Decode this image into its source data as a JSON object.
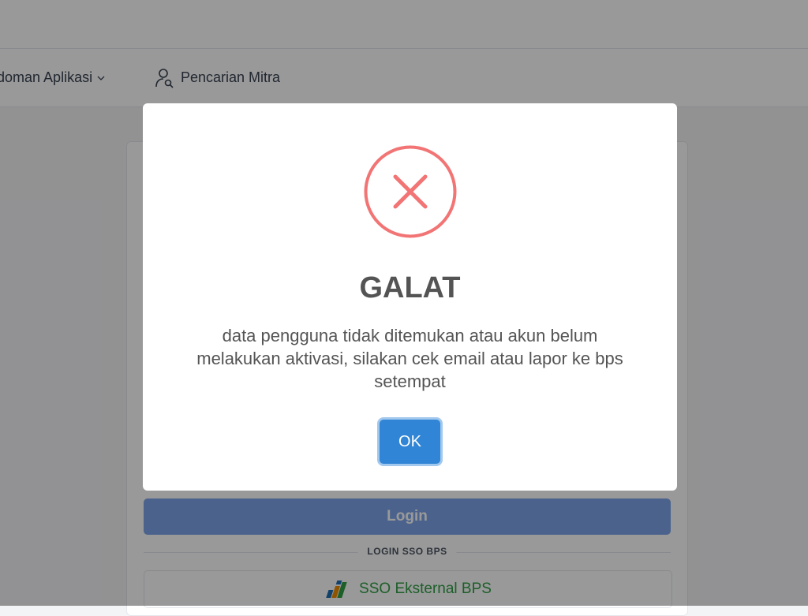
{
  "nav": {
    "pedoman_label": "edoman Aplikasi",
    "mitra_label": "Pencarian Mitra"
  },
  "login": {
    "button_label": "Login",
    "sso_divider": "LOGIN SSO BPS",
    "sso_button_label": "SSO Eksternal BPS"
  },
  "dialog": {
    "icon": "error-x-icon",
    "title": "GALAT",
    "message": "data pengguna tidak ditemukan atau akun belum melakukan aktivasi, silakan cek email atau lapor ke bps setempat",
    "ok_label": "OK"
  },
  "colors": {
    "error": "#f27474",
    "confirm": "#3085d6",
    "login_button": "#7ea6ea",
    "sso_text": "#2f9e44"
  }
}
